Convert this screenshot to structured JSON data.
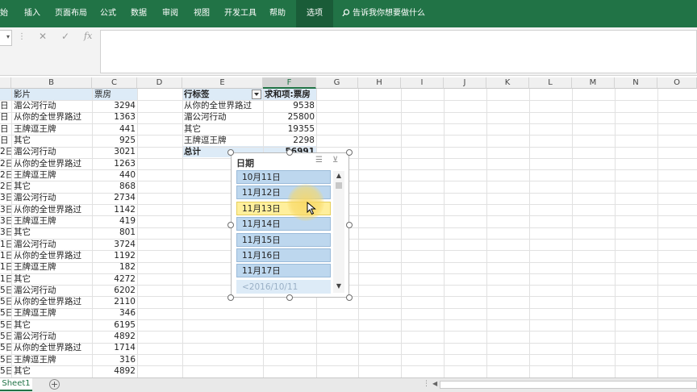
{
  "ribbon": {
    "tabs": [
      "始",
      "插入",
      "页面布局",
      "公式",
      "数据",
      "审阅",
      "视图",
      "开发工具",
      "帮助",
      "选项"
    ],
    "tell_me": "告诉我你想要做什么"
  },
  "formula_bar": {
    "fx": "fx",
    "cancel": "✕",
    "enter": "✓"
  },
  "columns": [
    "B",
    "C",
    "D",
    "E",
    "F",
    "G",
    "H",
    "I",
    "J",
    "K",
    "L",
    "M",
    "N",
    "O"
  ],
  "source_table": {
    "headers": [
      "影片",
      "票房"
    ],
    "rows": [
      [
        "日",
        "湄公河行动",
        "3294"
      ],
      [
        "日",
        "从你的全世界路过",
        "1363"
      ],
      [
        "日",
        "王牌逗王牌",
        "441"
      ],
      [
        "日",
        "其它",
        "925"
      ],
      [
        "2日",
        "湄公河行动",
        "3021"
      ],
      [
        "2日",
        "从你的全世界路过",
        "1263"
      ],
      [
        "2日",
        "王牌逗王牌",
        "440"
      ],
      [
        "2日",
        "其它",
        "868"
      ],
      [
        "3日",
        "湄公河行动",
        "2734"
      ],
      [
        "3日",
        "从你的全世界路过",
        "1142"
      ],
      [
        "3日",
        "王牌逗王牌",
        "419"
      ],
      [
        "3日",
        "其它",
        "801"
      ],
      [
        "1日",
        "湄公河行动",
        "3724"
      ],
      [
        "1日",
        "从你的全世界路过",
        "1192"
      ],
      [
        "1日",
        "王牌逗王牌",
        "182"
      ],
      [
        "1日",
        "其它",
        "4272"
      ],
      [
        "5日",
        "湄公河行动",
        "6202"
      ],
      [
        "5日",
        "从你的全世界路过",
        "2110"
      ],
      [
        "5日",
        "王牌逗王牌",
        "346"
      ],
      [
        "5日",
        "其它",
        "6195"
      ],
      [
        "5日",
        "湄公河行动",
        "4892"
      ],
      [
        "5日",
        "从你的全世界路过",
        "1714"
      ],
      [
        "5日",
        "王牌逗王牌",
        "316"
      ],
      [
        "5日",
        "其它",
        "4892"
      ]
    ]
  },
  "pivot": {
    "row_label": "行标签",
    "value_label": "求和项:票房",
    "rows": [
      [
        "从你的全世界路过",
        "9538"
      ],
      [
        "湄公河行动",
        "25800"
      ],
      [
        "其它",
        "19355"
      ],
      [
        "王牌逗王牌",
        "2298"
      ]
    ],
    "total_label": "总计",
    "total_value": "56991"
  },
  "slicer": {
    "title": "日期",
    "items": [
      "10月11日",
      "11月12日",
      "11月13日",
      "11月14日",
      "11月15日",
      "11月16日",
      "11月17日",
      "<2016/10/11"
    ],
    "hovered_index": 2
  },
  "sheets": [
    "Sheet1"
  ]
}
